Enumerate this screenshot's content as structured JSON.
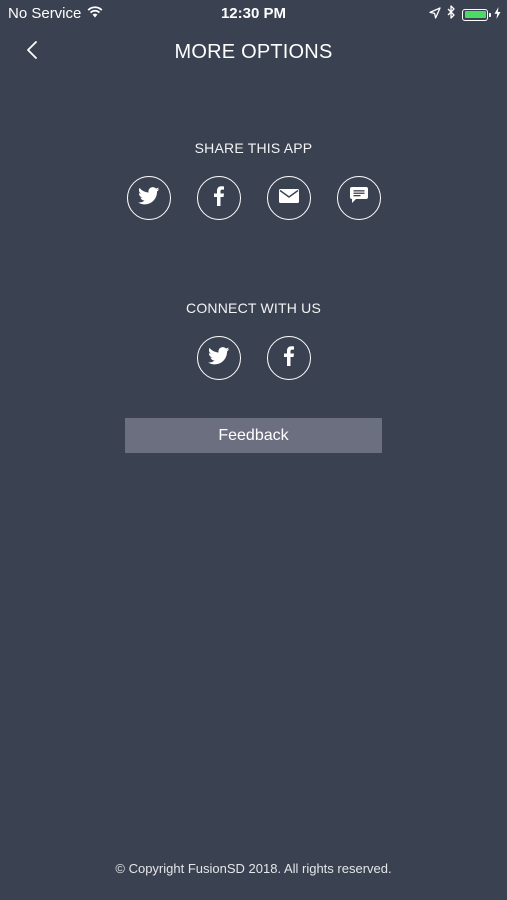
{
  "status_bar": {
    "carrier": "No Service",
    "time": "12:30 PM",
    "battery_level": 1.0,
    "icons": [
      "wifi-icon",
      "location-arrow-icon",
      "bluetooth-icon",
      "battery-icon",
      "charging-bolt-icon"
    ]
  },
  "nav": {
    "title": "MORE OPTIONS",
    "back_icon": "chevron-left-icon"
  },
  "share": {
    "label": "SHARE THIS APP",
    "icons": [
      "twitter-icon",
      "facebook-icon",
      "mail-icon",
      "message-icon"
    ]
  },
  "connect": {
    "label": "CONNECT WITH US",
    "icons": [
      "twitter-icon",
      "facebook-icon"
    ]
  },
  "feedback": {
    "label": "Feedback"
  },
  "footer": {
    "copyright": "© Copyright FusionSD 2018. All rights reserved."
  },
  "colors": {
    "background": "#3a4150",
    "button": "#6b6f80",
    "battery": "#4cd964",
    "text": "#ffffff"
  }
}
